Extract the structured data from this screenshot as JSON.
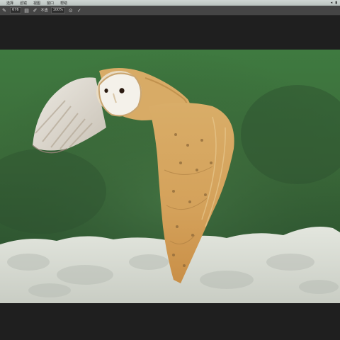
{
  "menubar": {
    "items": [
      "选择",
      "滤镜",
      "视图",
      "窗口",
      "帮助"
    ],
    "right_icons": [
      "volume-icon",
      "battery-icon"
    ]
  },
  "options_bar": {
    "size_value": "676",
    "opacity_label": "不透",
    "flow_value": "100%"
  },
  "canvas": {
    "subject": "barn owl painting",
    "colors": {
      "background_green": "#3c6a3a",
      "cloud": "#d9ddd4",
      "owl_buff": "#d8aa66",
      "owl_face": "#f2efe9"
    }
  }
}
